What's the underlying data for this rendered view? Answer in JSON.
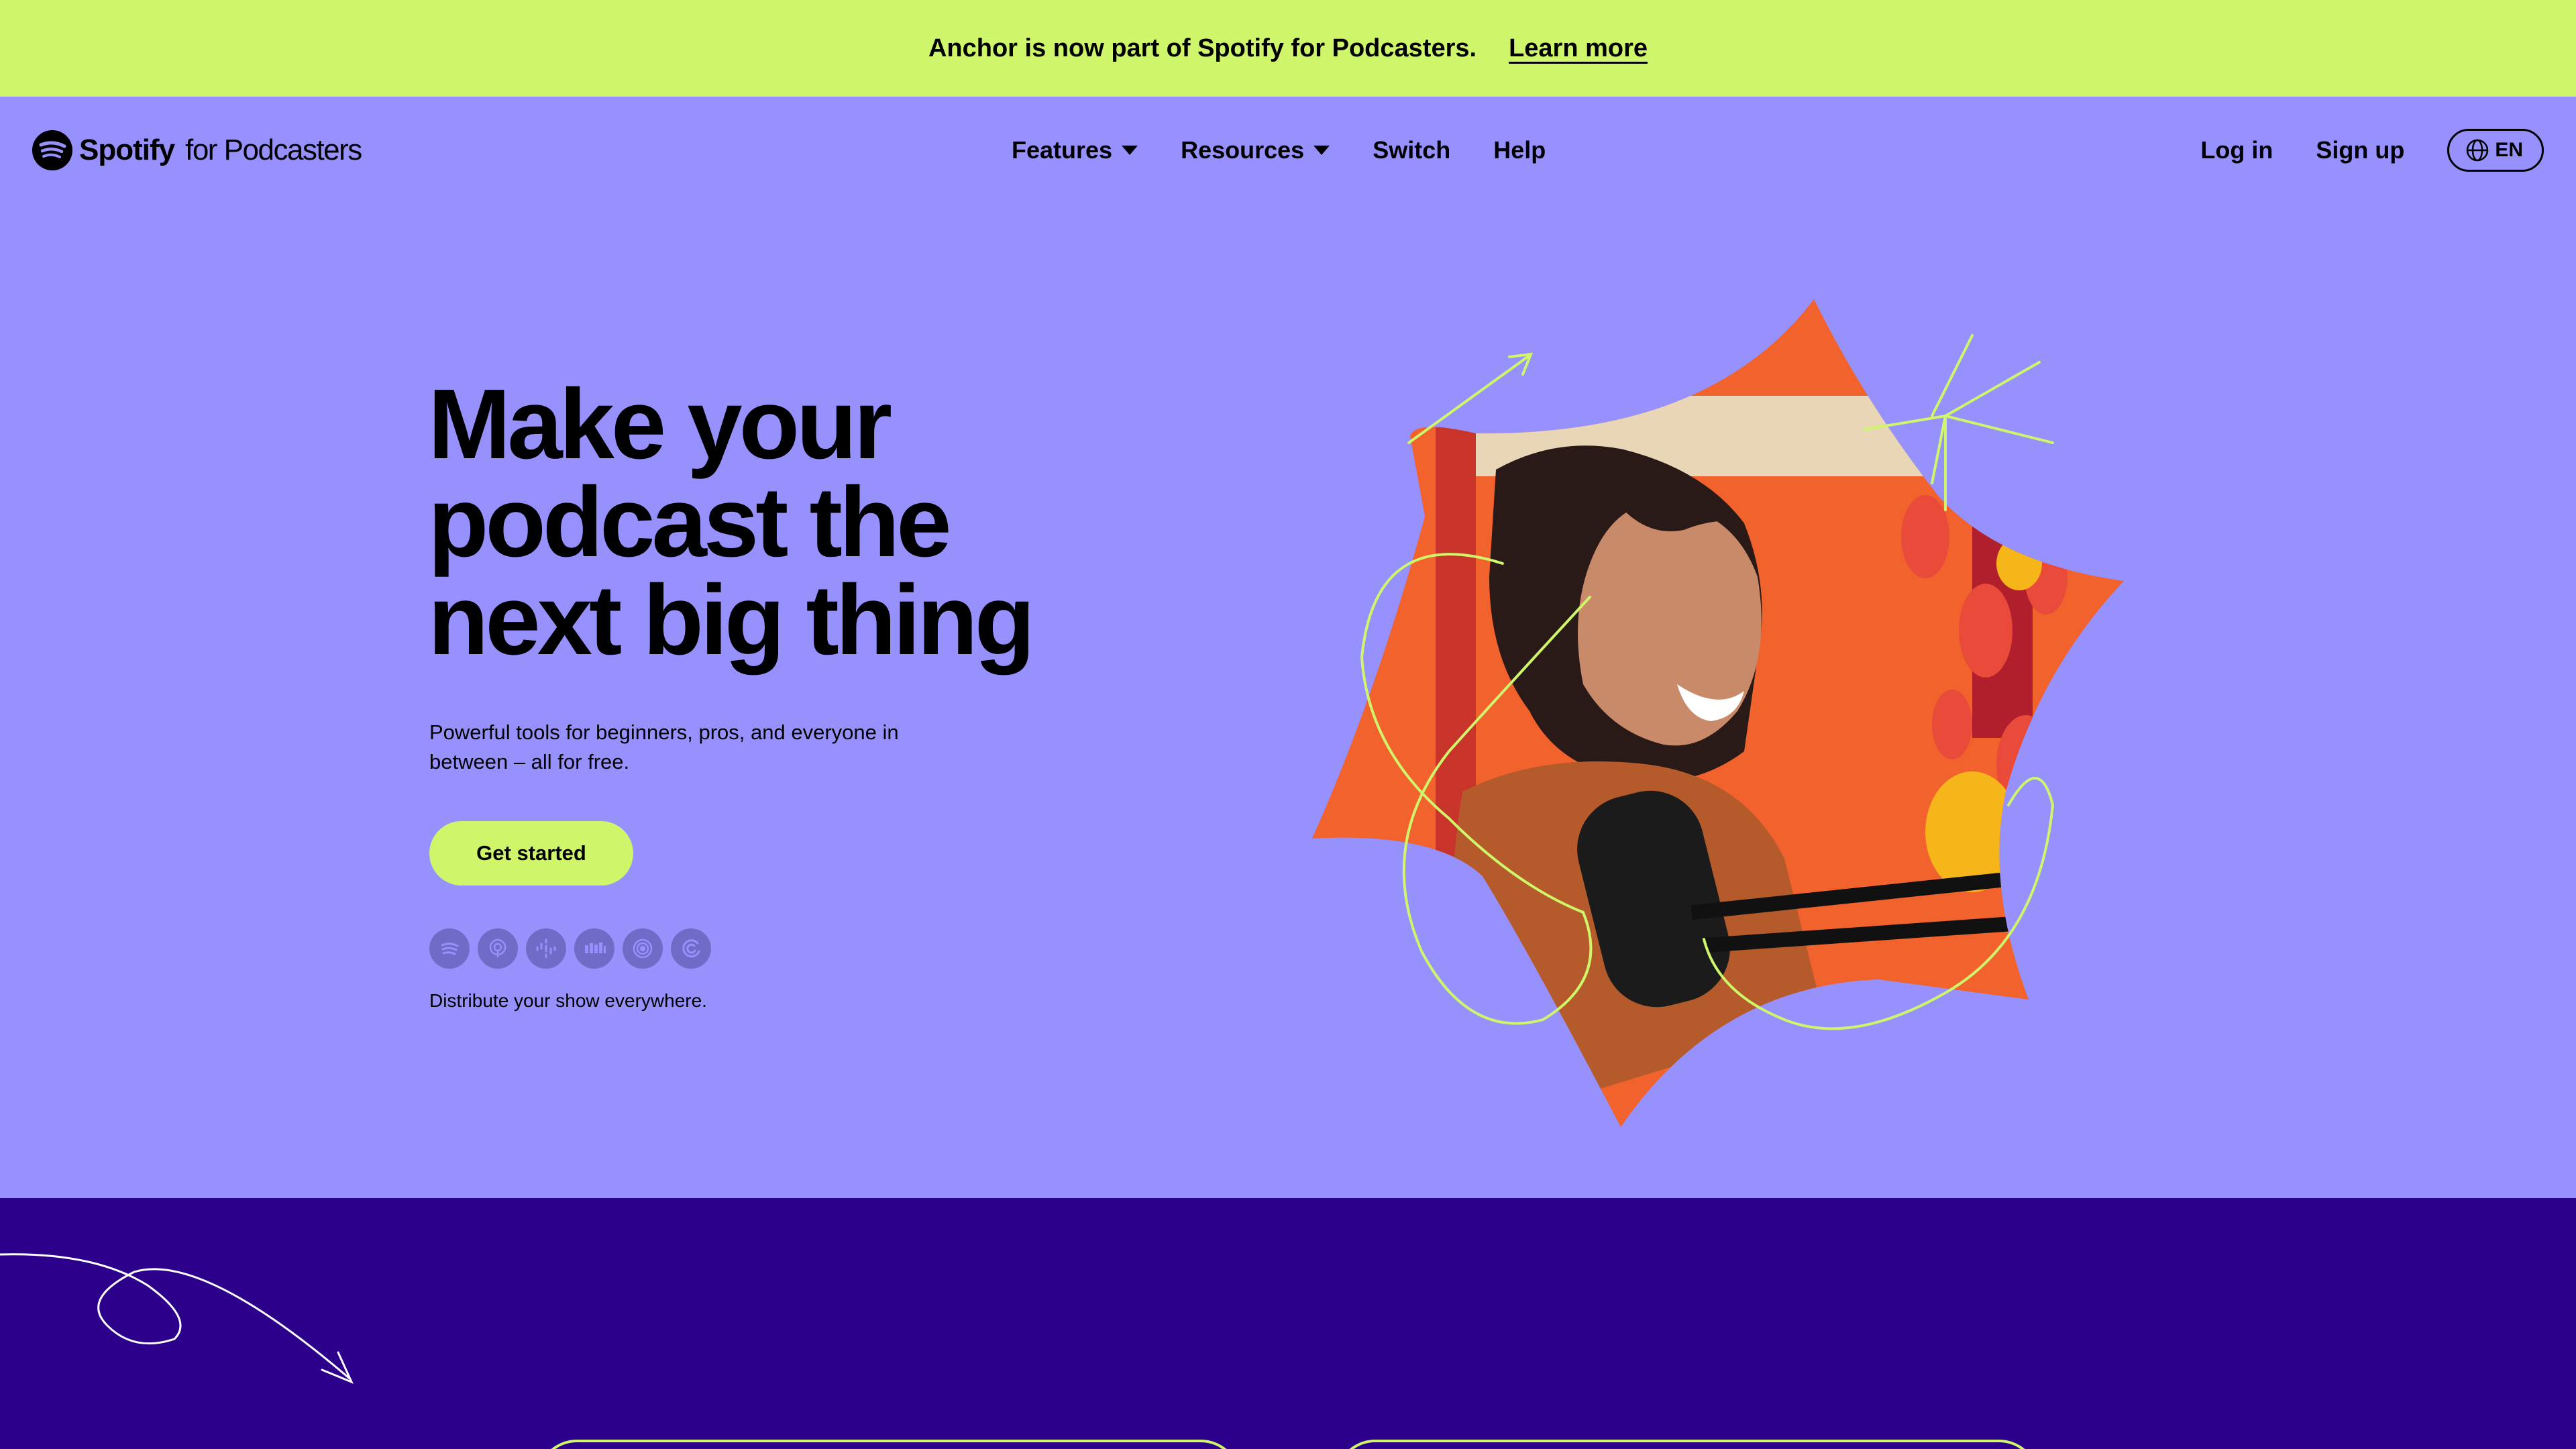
{
  "banner": {
    "text": "Anchor is now part of Spotify for Podcasters.",
    "link": "Learn more"
  },
  "nav": {
    "logo_brand": "Spotify",
    "logo_sub": "for Podcasters",
    "items": [
      {
        "label": "Features",
        "has_dropdown": true
      },
      {
        "label": "Resources",
        "has_dropdown": true
      },
      {
        "label": "Switch",
        "has_dropdown": false
      },
      {
        "label": "Help",
        "has_dropdown": false
      }
    ],
    "login": "Log in",
    "signup": "Sign up",
    "language": "EN"
  },
  "hero": {
    "title_lines": [
      "Make your",
      "podcast the",
      "next big thing"
    ],
    "subtitle": "Powerful tools for beginners, pros, and everyone in between – all for free.",
    "cta": "Get started",
    "platforms": [
      "spotify-icon",
      "apple-podcasts-icon",
      "google-podcasts-icon",
      "stitcher-icon",
      "pocket-casts-icon",
      "castbox-icon"
    ],
    "distribute": "Distribute your show everywhere."
  },
  "colors": {
    "banner_bg": "#cff56a",
    "hero_bg": "#9691fc",
    "accent": "#cff56a",
    "lower_bg": "#2d008c"
  }
}
